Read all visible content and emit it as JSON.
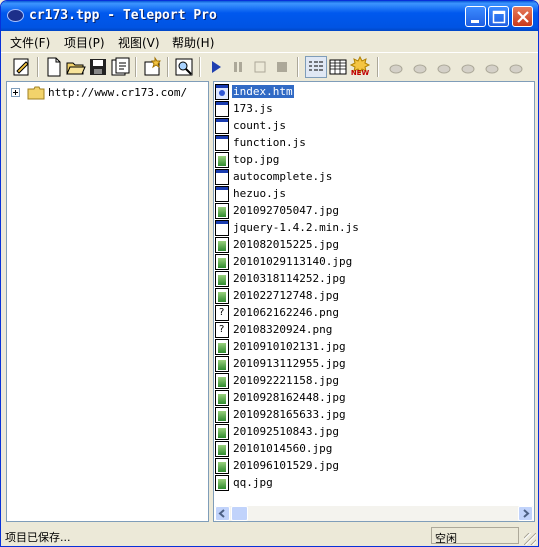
{
  "window": {
    "title": "cr173.tpp - Teleport Pro"
  },
  "menu": [
    {
      "label": "文件(F)"
    },
    {
      "label": "项目(P)"
    },
    {
      "label": "视图(V)"
    },
    {
      "label": "帮助(H)"
    }
  ],
  "toolbar": {
    "buttons": [
      "edit-icon",
      "new-icon",
      "open-icon",
      "save-icon",
      "properties-icon",
      "wizard-icon",
      "browse-icon",
      "start-icon",
      "pause-icon",
      "stop-icon",
      "stop-all-icon",
      "list-view-icon",
      "grid-view-icon",
      "new-badge-icon"
    ],
    "new_badge": "NEW"
  },
  "tree": {
    "root": "http://www.cr173.com/"
  },
  "files": [
    {
      "name": "index.htm",
      "type": "htm",
      "selected": true
    },
    {
      "name": "173.js",
      "type": "js"
    },
    {
      "name": "count.js",
      "type": "js"
    },
    {
      "name": "function.js",
      "type": "js"
    },
    {
      "name": "top.jpg",
      "type": "jpg"
    },
    {
      "name": "autocomplete.js",
      "type": "js"
    },
    {
      "name": "hezuo.js",
      "type": "js"
    },
    {
      "name": "201092705047.jpg",
      "type": "jpg"
    },
    {
      "name": "jquery-1.4.2.min.js",
      "type": "js"
    },
    {
      "name": "201082015225.jpg",
      "type": "jpg"
    },
    {
      "name": "20101029113140.jpg",
      "type": "jpg"
    },
    {
      "name": "2010318114252.jpg",
      "type": "jpg"
    },
    {
      "name": "201022712748.jpg",
      "type": "jpg"
    },
    {
      "name": "201062162246.png",
      "type": "unk"
    },
    {
      "name": "20108320924.png",
      "type": "unk"
    },
    {
      "name": "2010910102131.jpg",
      "type": "jpg"
    },
    {
      "name": "2010913112955.jpg",
      "type": "jpg"
    },
    {
      "name": "201092221158.jpg",
      "type": "jpg"
    },
    {
      "name": "2010928162448.jpg",
      "type": "jpg"
    },
    {
      "name": "2010928165633.jpg",
      "type": "jpg"
    },
    {
      "name": "201092510843.jpg",
      "type": "jpg"
    },
    {
      "name": "20101014560.jpg",
      "type": "jpg"
    },
    {
      "name": "201096101529.jpg",
      "type": "jpg"
    },
    {
      "name": "qq.jpg",
      "type": "jpg"
    }
  ],
  "status": {
    "left": "项目已保存...",
    "right": "空闲"
  }
}
